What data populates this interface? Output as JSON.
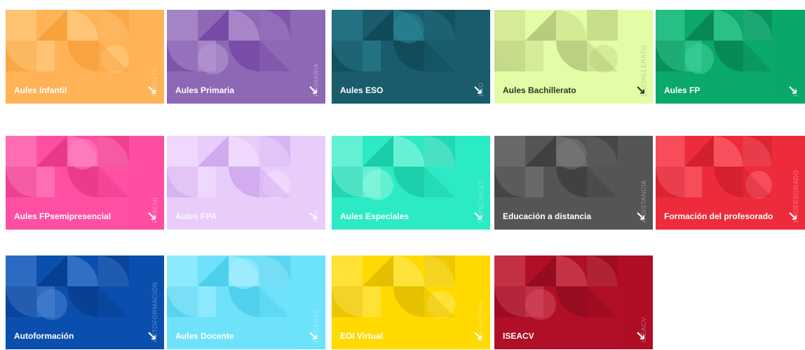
{
  "tiles": [
    {
      "id": "infantil",
      "label": "Aules Infantil",
      "side": "INFANTIL",
      "bg": "#ffb356",
      "shade": "#f59b35",
      "glow": "#ffd08a"
    },
    {
      "id": "primaria",
      "label": "Aules Primaria",
      "side": "PRIMARIA",
      "bg": "#8e68b4",
      "shade": "#6e3f9f",
      "glow": "#b89ad6"
    },
    {
      "id": "eso",
      "label": "Aules ESO",
      "side": "ESO",
      "bg": "#1a5c6b",
      "shade": "#0e4452",
      "glow": "#2a8597"
    },
    {
      "id": "bachillerato",
      "label": "Aules Bachillerato",
      "side": "BACHILLERATO",
      "bg": "#e3fca6",
      "shade": "#a4b86e",
      "glow": "#c8df8a"
    },
    {
      "id": "fp",
      "label": "Aules FP",
      "side": "FP",
      "bg": "#0aa86a",
      "shade": "#077a4c",
      "glow": "#3fd19a"
    },
    {
      "id": "fpsemi",
      "label": "Aules FPsemipresencial",
      "side": "FPSEMI",
      "bg": "#ff4fa3",
      "shade": "#e0327f",
      "glow": "#ff86c0"
    },
    {
      "id": "fpa",
      "label": "Aules FPA",
      "side": "FPA",
      "bg": "#e8cdfb",
      "shade": "#c69ae8",
      "glow": "#f3e2ff"
    },
    {
      "id": "especiales",
      "label": "Aules Especiales",
      "side": "ESPECIALES",
      "bg": "#2cebc4",
      "shade": "#16c19e",
      "glow": "#8ff5df"
    },
    {
      "id": "distancia",
      "label": "Educación a distancia",
      "side": "A DISTANCIA",
      "bg": "#555555",
      "shade": "#383838",
      "glow": "#7a7a7a"
    },
    {
      "id": "profesorado",
      "label": "Formación del profesorado",
      "side": "PROFESORADO",
      "bg": "#ee2b3b",
      "shade": "#c81c2a",
      "glow": "#ff6a76"
    },
    {
      "id": "autoformacion",
      "label": "Autoformación",
      "side": "AUTOFORMACIÓN",
      "bg": "#0b4fae",
      "shade": "#073a85",
      "glow": "#4b84d4"
    },
    {
      "id": "docente",
      "label": "Aules Docente",
      "side": "DOCENTE",
      "bg": "#6ee2fb",
      "shade": "#3fc8e6",
      "glow": "#a8efff"
    },
    {
      "id": "eoi",
      "label": "EOI Virtual",
      "side": "EOI VIRTUAL",
      "bg": "#ffd900",
      "shade": "#d9b400",
      "glow": "#ffe95e"
    },
    {
      "id": "iseacv",
      "label": "ISEACV",
      "side": "ISEACV",
      "bg": "#b00f27",
      "shade": "#8a0a1d",
      "glow": "#d34a5f"
    }
  ],
  "arrow_glyph": "↘"
}
